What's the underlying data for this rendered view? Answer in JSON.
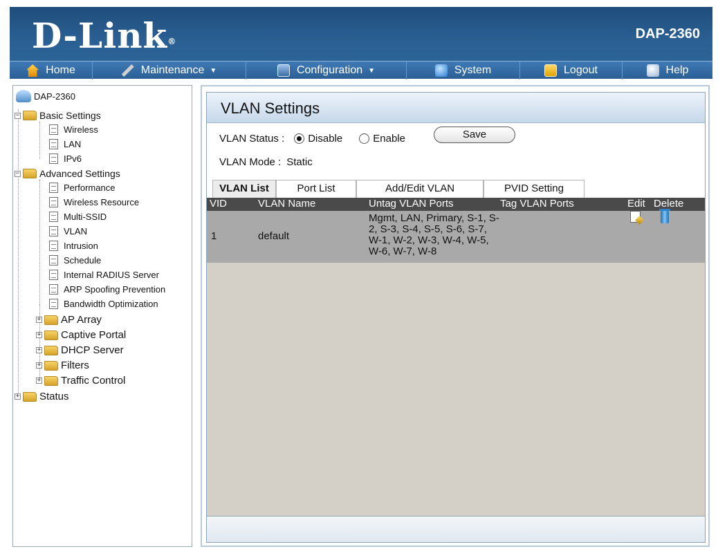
{
  "header": {
    "logo": "D-Link",
    "model": "DAP-2360"
  },
  "nav": [
    {
      "label": "Home",
      "icon": "home-icon"
    },
    {
      "label": "Maintenance",
      "icon": "tools-icon",
      "dropdown": true
    },
    {
      "label": "Configuration",
      "icon": "disk-icon",
      "dropdown": true
    },
    {
      "label": "System",
      "icon": "globe-icon"
    },
    {
      "label": "Logout",
      "icon": "key-icon"
    },
    {
      "label": "Help",
      "icon": "help-icon"
    }
  ],
  "tree": {
    "root": "DAP-2360",
    "basic": "Basic Settings",
    "basic_items": [
      "Wireless",
      "LAN",
      "IPv6"
    ],
    "advanced": "Advanced Settings",
    "advanced_items": [
      "Performance",
      "Wireless Resource",
      "Multi-SSID",
      "VLAN",
      "Intrusion",
      "Schedule",
      "Internal RADIUS Server",
      "ARP Spoofing Prevention",
      "Bandwidth Optimization"
    ],
    "advanced_folders": [
      "AP Array",
      "Captive Portal",
      "DHCP Server",
      "Filters",
      "Traffic Control"
    ],
    "status": "Status"
  },
  "vlan": {
    "title": "VLAN Settings",
    "status_label": "VLAN Status :",
    "disable": "Disable",
    "enable": "Enable",
    "status_value": "Disable",
    "save": "Save",
    "mode_label": "VLAN Mode :",
    "mode_value": "Static",
    "tabs": [
      "VLAN List",
      "Port List",
      "Add/Edit VLAN",
      "PVID Setting"
    ],
    "active_tab": "VLAN List",
    "columns": [
      "VID",
      "VLAN Name",
      "Untag VLAN Ports",
      "Tag VLAN Ports",
      "Edit",
      "Delete"
    ],
    "rows": [
      {
        "vid": "1",
        "name": "default",
        "untag": "Mgmt, LAN, Primary, S-1, S-2, S-3, S-4, S-5, S-6, S-7, W-1, W-2, W-3, W-4, W-5, W-6, W-7, W-8",
        "tag": ""
      }
    ]
  },
  "colors": {
    "header_bg": "#2a5f92",
    "nav_bg": "#2b5f96",
    "table_header": "#4a4a4a",
    "row_bg": "#a9a9a9",
    "content_bg": "#d4d0c8"
  }
}
